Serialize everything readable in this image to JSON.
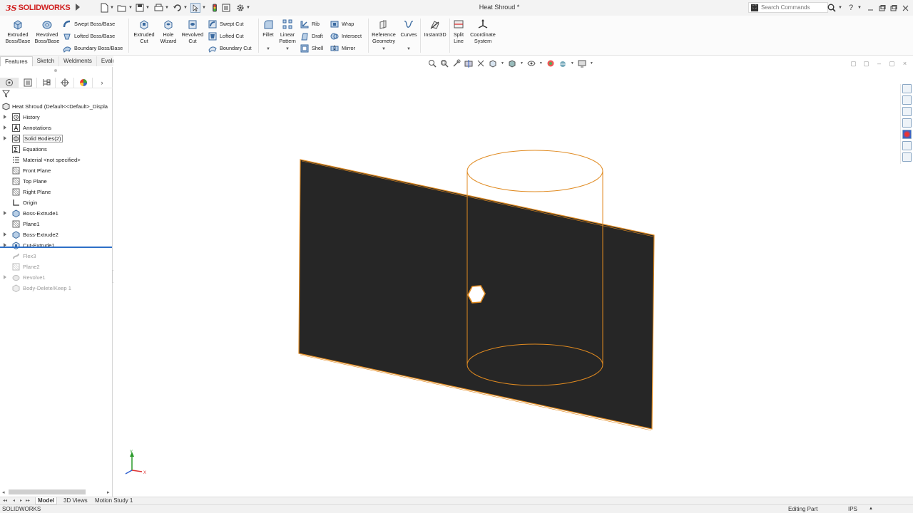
{
  "app": {
    "logo_prefix": "3S",
    "name": "SOLIDWORKS",
    "document_title": "Heat Shroud *"
  },
  "search": {
    "placeholder": "Search Commands"
  },
  "ribbon": {
    "extruded_boss": "Extruded Boss/Base",
    "revolved_boss": "Revolved Boss/Base",
    "swept_boss": "Swept Boss/Base",
    "lofted_boss": "Lofted Boss/Base",
    "boundary_boss": "Boundary Boss/Base",
    "extruded_cut": "Extruded Cut",
    "hole_wizard": "Hole Wizard",
    "revolved_cut": "Revolved Cut",
    "swept_cut": "Swept Cut",
    "lofted_cut": "Lofted Cut",
    "boundary_cut": "Boundary Cut",
    "fillet": "Fillet",
    "linear_pattern": "Linear Pattern",
    "rib": "Rib",
    "draft": "Draft",
    "shell": "Shell",
    "wrap": "Wrap",
    "intersect": "Intersect",
    "mirror": "Mirror",
    "reference_geometry": "Reference Geometry",
    "curves": "Curves",
    "instant3d": "Instant3D",
    "split_line": "Split Line",
    "coordinate_system": "Coordinate System"
  },
  "command_tabs": [
    "Features",
    "Sketch",
    "Weldments",
    "Evaluate"
  ],
  "tree": {
    "root": "Heat Shroud  (Default<<Default>_Displa",
    "items": [
      {
        "label": "History"
      },
      {
        "label": "Annotations"
      },
      {
        "label": "Solid Bodies(2)"
      },
      {
        "label": "Equations"
      },
      {
        "label": "Material <not specified>"
      },
      {
        "label": "Front Plane"
      },
      {
        "label": "Top Plane"
      },
      {
        "label": "Right Plane"
      },
      {
        "label": "Origin"
      },
      {
        "label": "Boss-Extrude1"
      },
      {
        "label": "Plane1"
      },
      {
        "label": "Boss-Extrude2"
      },
      {
        "label": "Cut-Extrude1"
      },
      {
        "label": "Flex3"
      },
      {
        "label": "Plane2"
      },
      {
        "label": "Revolve1"
      },
      {
        "label": "Body-Delete/Keep 1"
      }
    ]
  },
  "triad": {
    "y": "Y",
    "x": "X"
  },
  "bottom_tabs": [
    "Model",
    "3D Views",
    "Motion Study 1"
  ],
  "status": {
    "app": "SOLIDWORKS",
    "mode": "Editing Part",
    "units": "IPS"
  },
  "colors": {
    "accent_blue": "#2d6fc7",
    "edge_orange": "#e08a20",
    "body_dark": "#262626",
    "brand_red": "#d02020"
  }
}
